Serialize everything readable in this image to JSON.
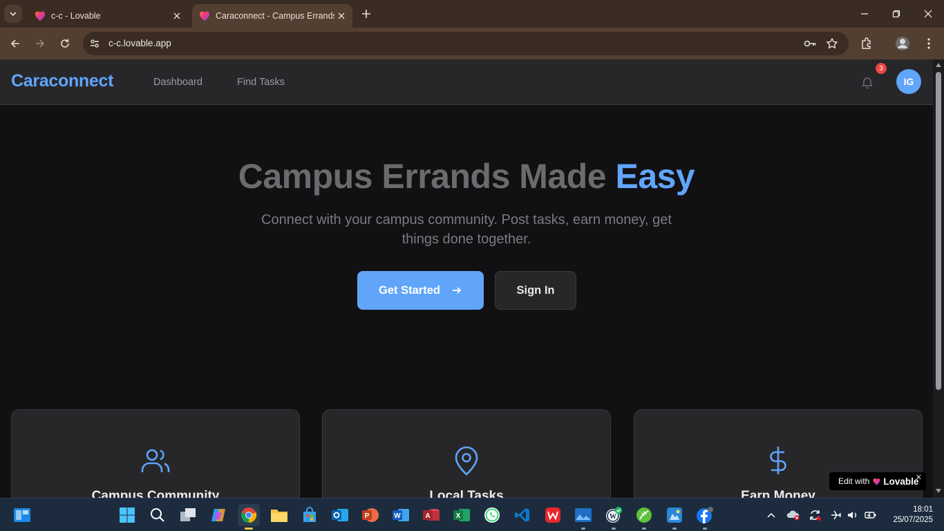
{
  "browser": {
    "tabs": [
      {
        "title": "c-c - Lovable",
        "active": false
      },
      {
        "title": "Caraconnect - Campus Errands",
        "active": true
      }
    ],
    "url": "c-c.lovable.app"
  },
  "app": {
    "logo": "Caraconnect",
    "nav": [
      "Dashboard",
      "Find Tasks"
    ],
    "notification_count": "3",
    "avatar_initials": "IG",
    "accent_color": "#60a5fa"
  },
  "hero": {
    "title_main": "Campus Errands Made ",
    "title_accent": "Easy",
    "subtitle": "Connect with your campus community. Post tasks, earn money, get things done together.",
    "primary_button": "Get Started",
    "secondary_button": "Sign In"
  },
  "features": [
    {
      "title": "Campus Community",
      "icon": "users-icon"
    },
    {
      "title": "Local Tasks",
      "icon": "map-pin-icon"
    },
    {
      "title": "Earn Money",
      "icon": "dollar-icon"
    }
  ],
  "lovable_badge": {
    "prefix": "Edit with",
    "brand": "Lovable"
  },
  "taskbar": {
    "time": "18:01",
    "date": "25/07/2025"
  }
}
